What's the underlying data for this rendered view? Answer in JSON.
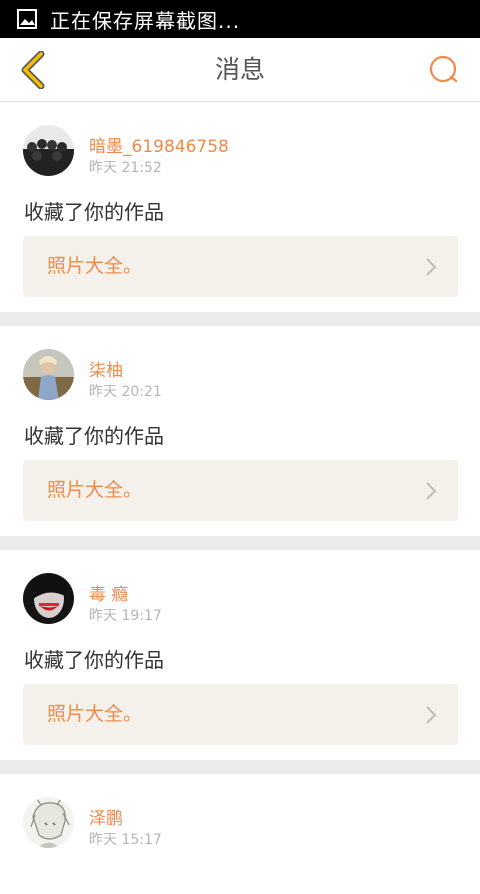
{
  "status_bar": {
    "text": "正在保存屏幕截图..."
  },
  "header": {
    "title": "消息"
  },
  "colors": {
    "accent": "#f08a4b",
    "link_bg": "#f3f1ea",
    "back_arrow": "#f2c200"
  },
  "messages": [
    {
      "name": "暗墨_619846758",
      "time": "昨天 21:52",
      "action": "收藏了你的作品",
      "work": "照片大全。"
    },
    {
      "name": "柒柚",
      "time": "昨天 20:21",
      "action": "收藏了你的作品",
      "work": "照片大全。"
    },
    {
      "name": "毒 瘾",
      "time": "昨天 19:17",
      "action": "收藏了你的作品",
      "work": "照片大全。"
    },
    {
      "name": "泽鹏",
      "time": "昨天 15:17"
    }
  ]
}
